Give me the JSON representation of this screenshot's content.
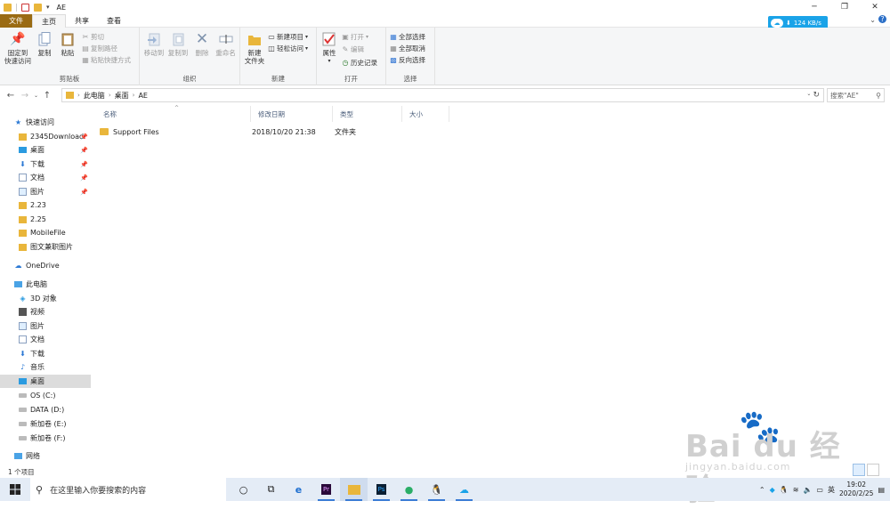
{
  "window": {
    "title": "AE"
  },
  "ribbon_tabs": [
    "文件",
    "主页",
    "共享",
    "查看"
  ],
  "ribbon": {
    "clipboard": {
      "pin_label": "固定到\n快速访问",
      "copy": "复制",
      "paste": "粘贴",
      "cut": "剪切",
      "copy_path": "复制路径",
      "paste_shortcut": "粘贴快捷方式",
      "group": "剪贴板"
    },
    "organize": {
      "move_to": "移动到",
      "copy_to": "复制到",
      "delete": "删除",
      "rename": "重命名",
      "group": "组织"
    },
    "new": {
      "new_folder": "新建\n文件夹",
      "new_item": "新建项目",
      "easy_access": "轻松访问",
      "group": "新建"
    },
    "open": {
      "properties": "属性",
      "open": "打开",
      "edit": "编辑",
      "history": "历史记录",
      "group": "打开"
    },
    "select": {
      "select_all": "全部选择",
      "select_none": "全部取消",
      "invert": "反向选择",
      "group": "选择"
    }
  },
  "net_speed": "124 KB/s",
  "address": {
    "crumbs": [
      "此电脑",
      "桌面",
      "AE"
    ],
    "search_placeholder": "搜索\"AE\""
  },
  "nav": {
    "quick_access": "快速访问",
    "quick_items": [
      "2345Download",
      "桌面",
      "下载",
      "文档",
      "图片",
      "2.23",
      "2.25",
      "MobileFile",
      "图文兼职图片"
    ],
    "onedrive": "OneDrive",
    "this_pc": "此电脑",
    "pc_items": [
      "3D 对象",
      "视频",
      "图片",
      "文档",
      "下载",
      "音乐",
      "桌面",
      "OS (C:)",
      "DATA (D:)",
      "新加卷 (E:)",
      "新加卷 (F:)"
    ],
    "network": "网络"
  },
  "columns": [
    "名称",
    "修改日期",
    "类型",
    "大小"
  ],
  "files": [
    {
      "name": "Support Files",
      "date": "2018/10/20 21:38",
      "type": "文件夹",
      "size": ""
    }
  ],
  "status": "1 个项目",
  "taskbar": {
    "search_placeholder": "在这里输入你要搜索的内容",
    "ime": "英",
    "time": "19:02",
    "date": "2020/2/25"
  },
  "watermark": {
    "brand": "Bai du 经验",
    "url": "jingyan.baidu.com"
  }
}
